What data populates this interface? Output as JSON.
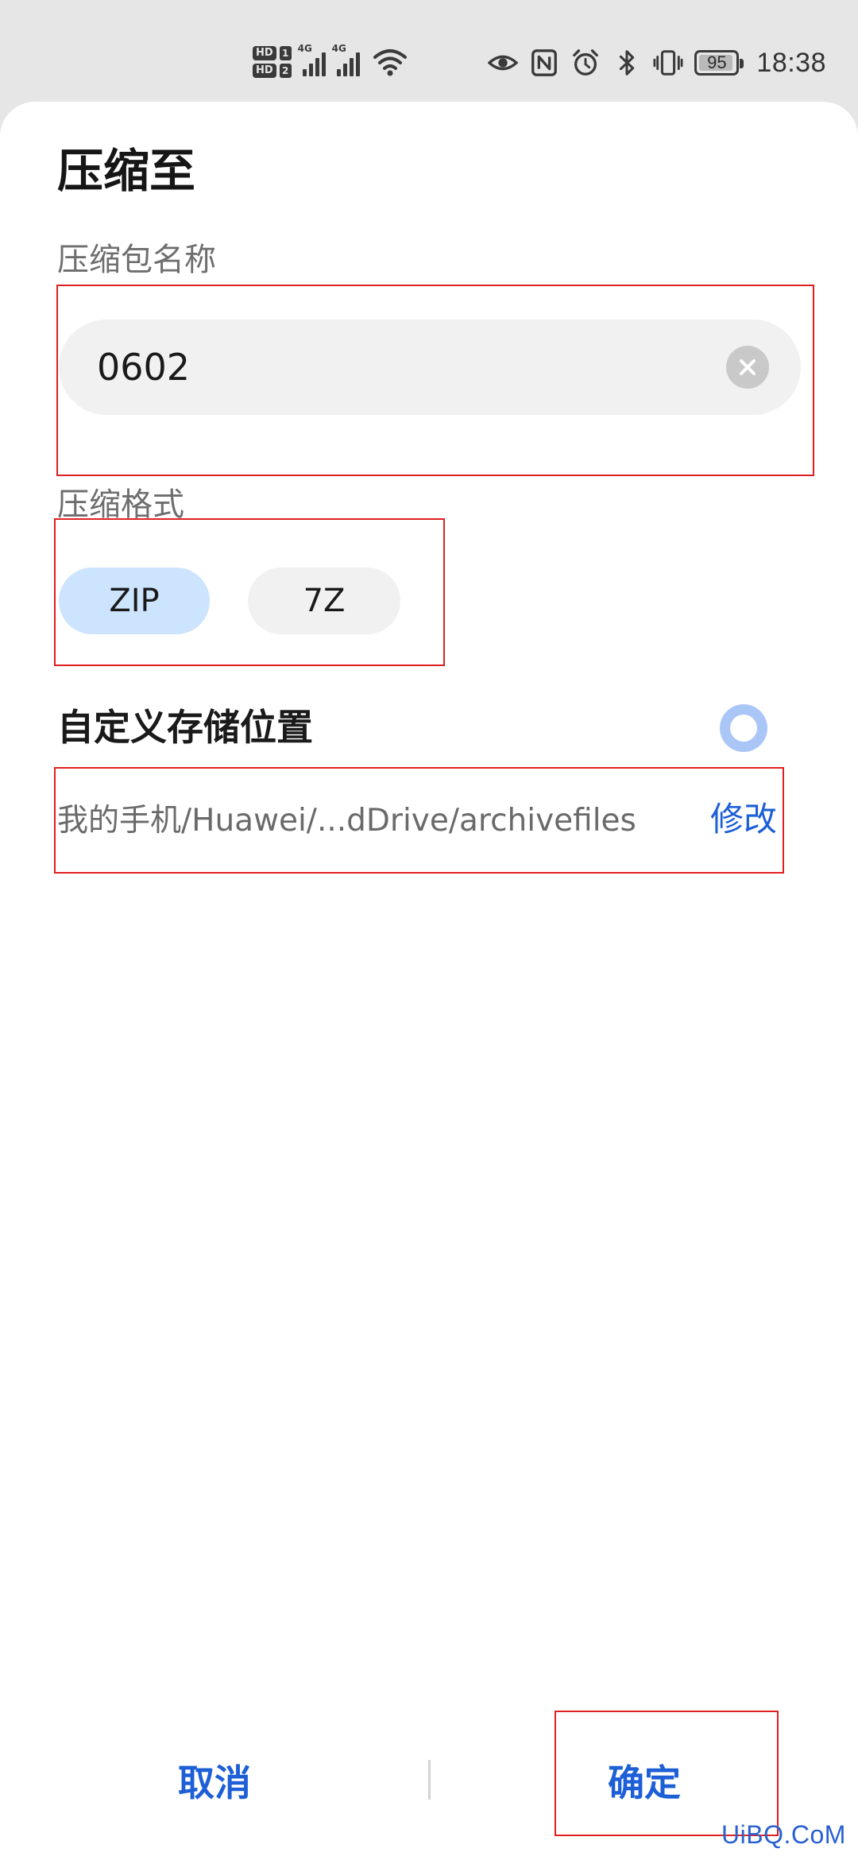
{
  "status_bar": {
    "hd1_label": "HD",
    "sim1": "1",
    "hd2_label": "HD",
    "sim2": "2",
    "net1": "4G",
    "net2": "4G",
    "battery_percent": "95",
    "battery_level": 0.95,
    "time": "18:38",
    "icons": [
      "eye-icon",
      "nfc-icon",
      "alarm-icon",
      "bluetooth-icon",
      "vibrate-icon",
      "battery-icon"
    ]
  },
  "dialog": {
    "title": "压缩至",
    "name_label": "压缩包名称",
    "name_value": "0602",
    "format_label": "压缩格式",
    "formats": [
      {
        "label": "ZIP",
        "selected": true
      },
      {
        "label": "7Z",
        "selected": false
      }
    ],
    "custom_location_title": "自定义存储位置",
    "custom_location_enabled": true,
    "path": "我的手机/Huawei/...dDrive/archivefiles",
    "modify_label": "修改",
    "cancel_label": "取消",
    "confirm_label": "确定"
  },
  "watermark": "UiBQ.CoM",
  "colors": {
    "accent": "#1d5fd6",
    "chip_selected": "#cce4fd",
    "chip_default": "#f1f1f1",
    "annotation": "#e02020",
    "toggle": "#a9c6f6"
  }
}
